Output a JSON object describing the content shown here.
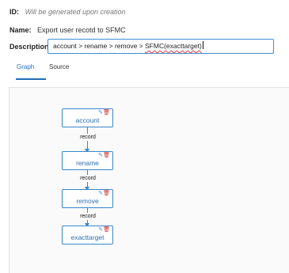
{
  "fields": {
    "id_label": "ID:",
    "id_value": "Will be generated upon creation",
    "name_label": "Name:",
    "name_value": "Export user recotd to SFMC",
    "description_label": "Description:",
    "description_value": "account > rename > remove > SFMC(exacttarget)"
  },
  "tabs": [
    {
      "label": "Graph",
      "active": true
    },
    {
      "label": "Source",
      "active": false
    }
  ],
  "graph": {
    "nodes": [
      {
        "label": "account",
        "edit_icon": "✎",
        "delete_icon": "🗑"
      },
      {
        "label": "rename",
        "edit_icon": "✎",
        "delete_icon": "🗑"
      },
      {
        "label": "remove",
        "edit_icon": "✎",
        "delete_icon": "🗑"
      },
      {
        "label": "exacttarget",
        "edit_icon": "✎",
        "delete_icon": "🗑"
      }
    ],
    "edges": [
      {
        "label": "record"
      },
      {
        "label": "record"
      },
      {
        "label": "record"
      }
    ]
  },
  "colors": {
    "accent": "#1f6fb8",
    "node_border": "#3b86c9",
    "delete_icon": "#d42b2b"
  }
}
